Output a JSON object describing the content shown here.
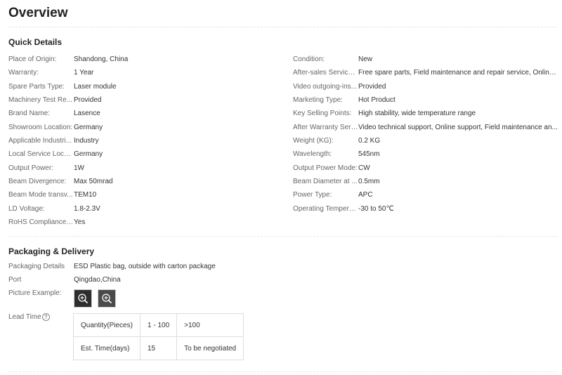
{
  "overview": {
    "title": "Overview"
  },
  "quick_details": {
    "title": "Quick Details",
    "left": [
      {
        "label": "Place of Origin:",
        "value": "Shandong, China"
      },
      {
        "label": "Warranty:",
        "value": "1 Year"
      },
      {
        "label": "Spare Parts Type:",
        "value": "Laser module"
      },
      {
        "label": "Machinery Test Re...",
        "value": "Provided"
      },
      {
        "label": "Brand Name:",
        "value": "Lasence"
      },
      {
        "label": "Showroom Location:",
        "value": "Germany"
      },
      {
        "label": "Applicable Industri...",
        "value": "Industry"
      },
      {
        "label": "Local Service Locat...",
        "value": "Germany"
      },
      {
        "label": "Output Power:",
        "value": "1W"
      },
      {
        "label": "Beam Divergence:",
        "value": "Max 50mrad"
      },
      {
        "label": "Beam Mode transv...",
        "value": "TEM10"
      },
      {
        "label": "LD Voltage:",
        "value": "1.8-2.3V"
      },
      {
        "label": "RoHS Compliance ...",
        "value": "Yes"
      }
    ],
    "right": [
      {
        "label": "Condition:",
        "value": "New"
      },
      {
        "label": "After-sales Service ...",
        "value": "Free spare parts, Field maintenance and repair service, Online ..."
      },
      {
        "label": "Video outgoing-ins...",
        "value": "Provided"
      },
      {
        "label": "Marketing Type:",
        "value": "Hot Product"
      },
      {
        "label": "Key Selling Points:",
        "value": "High stability, wide temperature range"
      },
      {
        "label": "After Warranty Serv...",
        "value": "Video technical support, Online support, Field maintenance an..."
      },
      {
        "label": "Weight (KG):",
        "value": "0.2 KG"
      },
      {
        "label": "Wavelength:",
        "value": "545nm"
      },
      {
        "label": "Output Power Mode:",
        "value": "CW"
      },
      {
        "label": "Beam Diameter at ...",
        "value": "0.5mm"
      },
      {
        "label": "Power Type:",
        "value": "APC"
      },
      {
        "label": "Operating Tempera...",
        "value": "-30 to 50℃"
      }
    ]
  },
  "packaging": {
    "title": "Packaging & Delivery",
    "details_label": "Packaging Details",
    "details_value": "ESD Plastic bag, outside with carton package",
    "port_label": "Port",
    "port_value": "Qingdao,China",
    "picture_label": "Picture Example:",
    "lead_time_label": "Lead Time",
    "help_glyph": "?",
    "lead_table": {
      "row1": [
        "Quantity(Pieces)",
        "1 - 100",
        ">100"
      ],
      "row2": [
        "Est. Time(days)",
        "15",
        "To be negotiated"
      ]
    }
  }
}
